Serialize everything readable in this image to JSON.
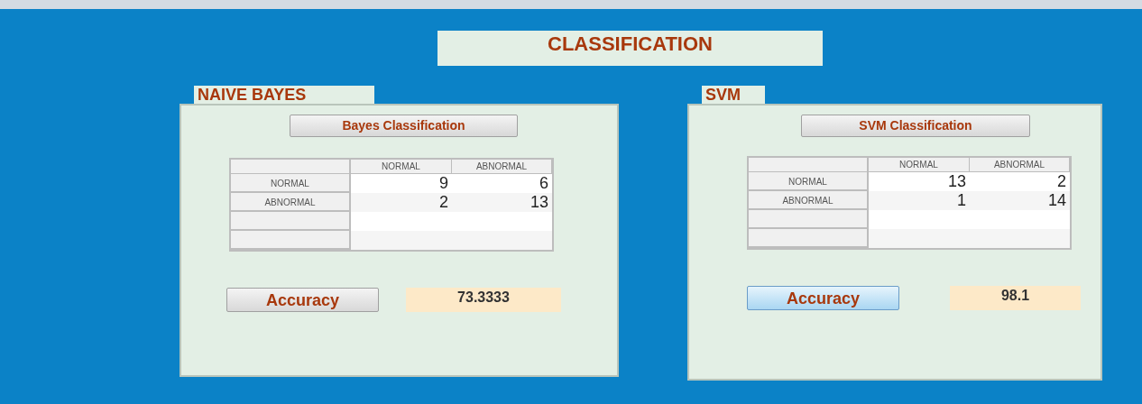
{
  "title": "CLASSIFICATION",
  "panels": [
    {
      "title": "NAIVE BAYES",
      "button": "Bayes Classification",
      "columns": [
        "NORMAL",
        "ABNORMAL"
      ],
      "rows": [
        {
          "label": "NORMAL",
          "cells": [
            "9",
            "6"
          ]
        },
        {
          "label": "ABNORMAL",
          "cells": [
            "2",
            "13"
          ]
        }
      ],
      "accuracy_button": {
        "label": "Accuracy",
        "focused": false
      },
      "accuracy_value": "73.3333"
    },
    {
      "title": "SVM",
      "button": "SVM Classification",
      "columns": [
        "NORMAL",
        "ABNORMAL"
      ],
      "rows": [
        {
          "label": "NORMAL",
          "cells": [
            "13",
            "2"
          ]
        },
        {
          "label": "ABNORMAL",
          "cells": [
            "1",
            "14"
          ]
        }
      ],
      "accuracy_button": {
        "label": "Accuracy",
        "focused": true
      },
      "accuracy_value": "98.1"
    }
  ]
}
